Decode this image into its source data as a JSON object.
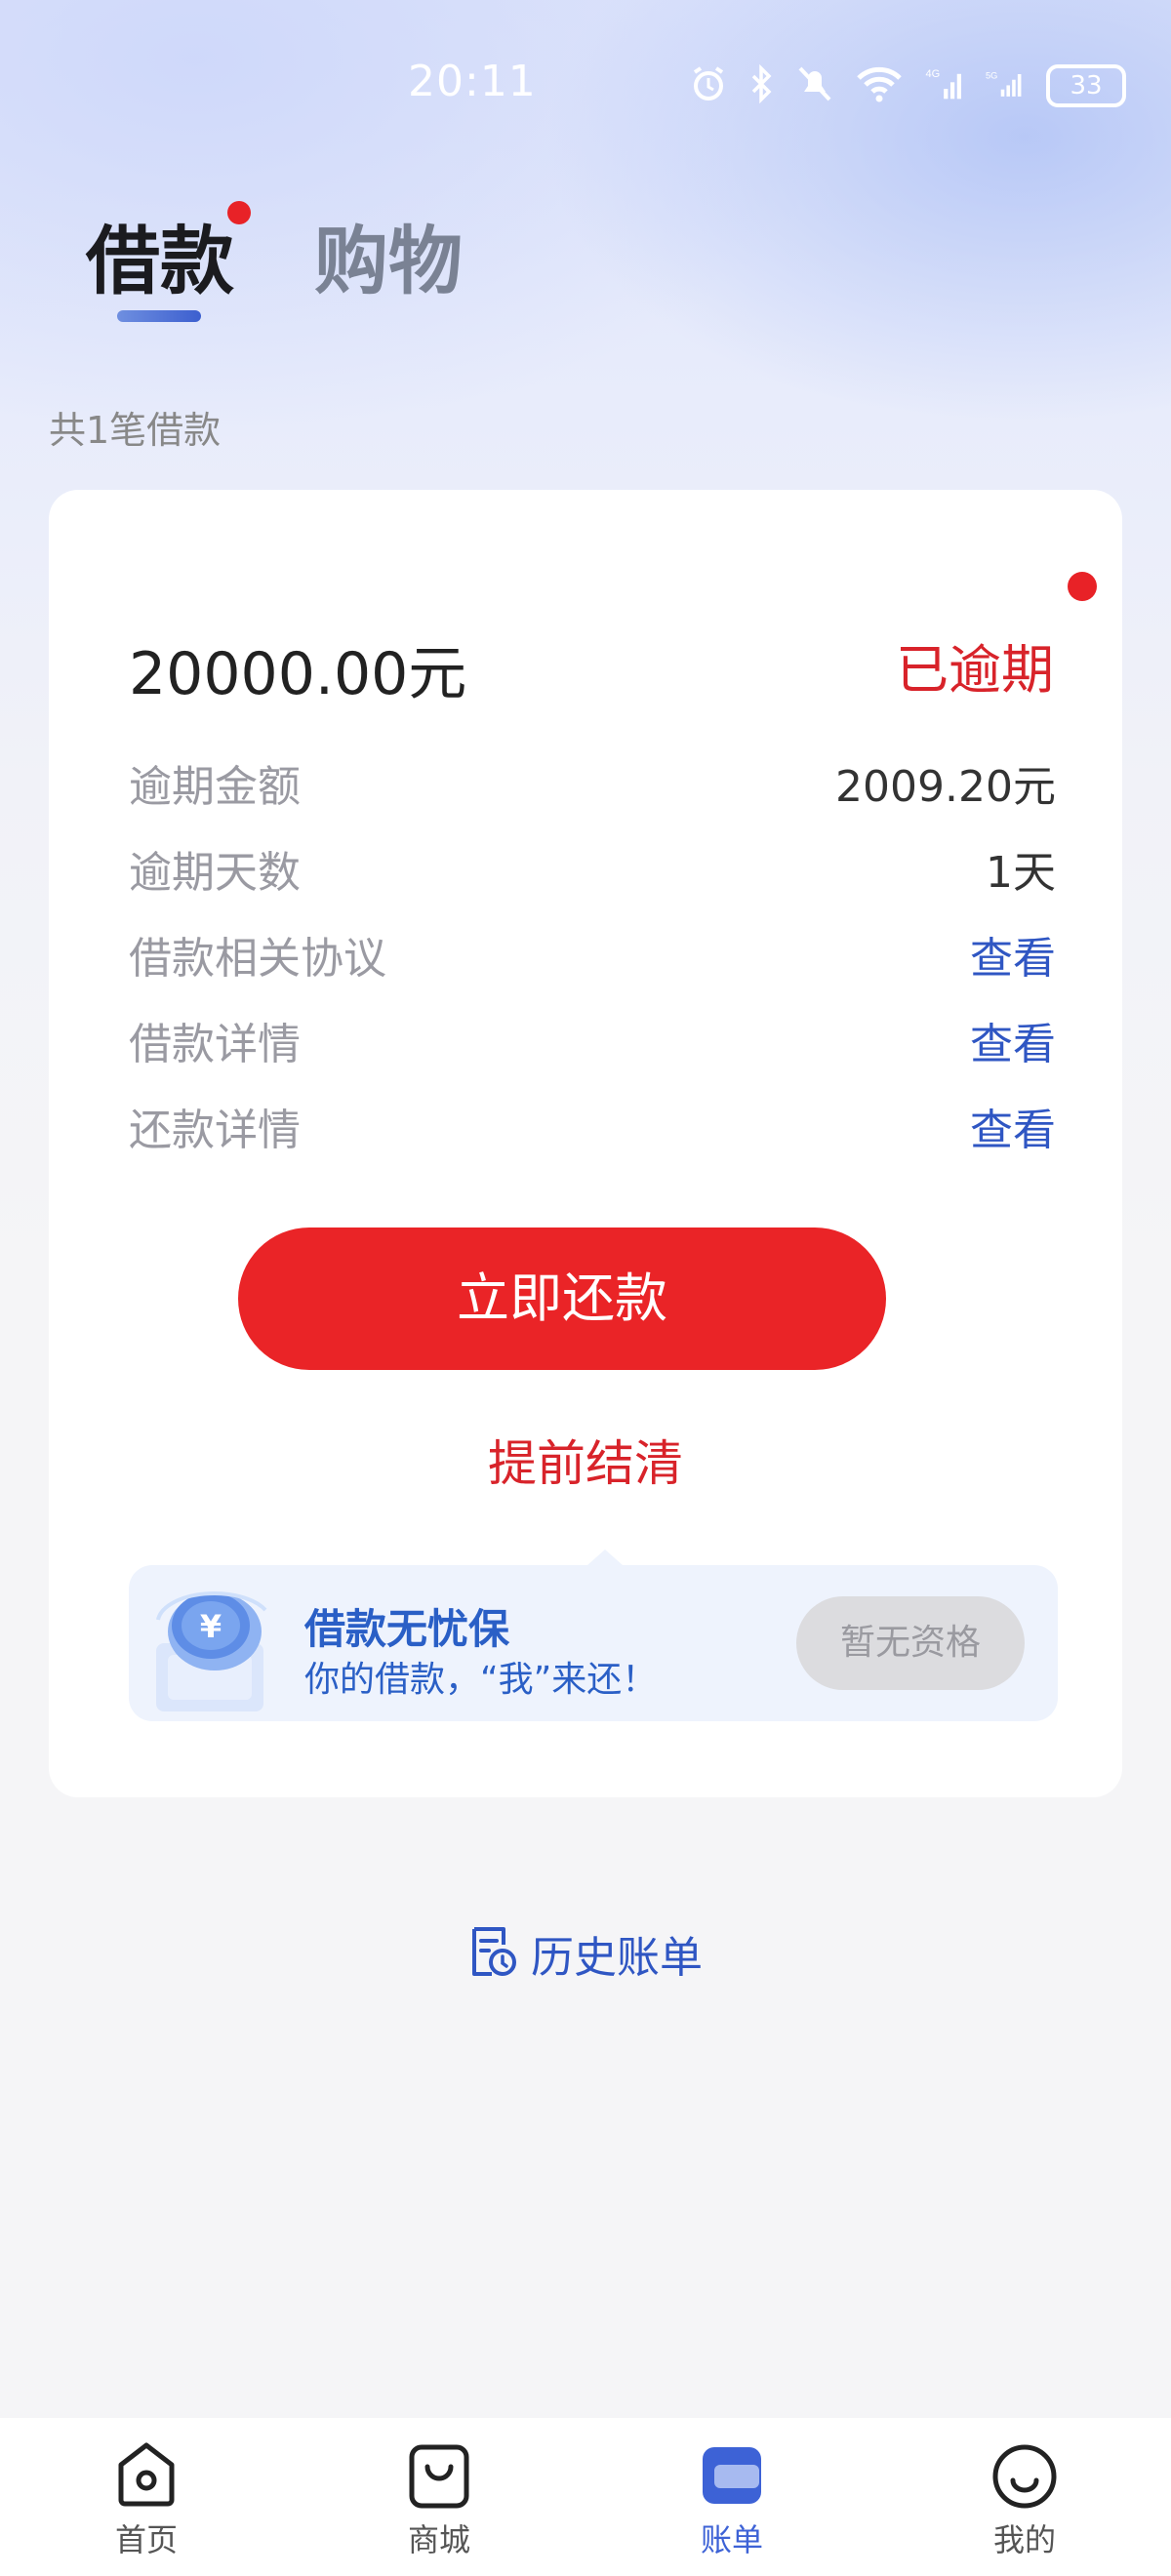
{
  "status_bar": {
    "time": "20:11",
    "battery": "33"
  },
  "tabs": {
    "loan": "借款",
    "shopping": "购物"
  },
  "loan_count": "共1笔借款",
  "loan_card": {
    "amount": "20000.00元",
    "status": "已逾期",
    "rows": [
      {
        "label": "逾期金额",
        "value": "2009.20元"
      },
      {
        "label": "逾期天数",
        "value": "1天"
      },
      {
        "label": "借款相关协议",
        "link": "查看"
      },
      {
        "label": "借款详情",
        "link": "查看"
      },
      {
        "label": "还款详情",
        "link": "查看"
      }
    ],
    "repay_button": "立即还款",
    "settle_link": "提前结清"
  },
  "promo": {
    "title": "借款无忧保",
    "subtitle": "你的借款，“我”来还！",
    "button": "暂无资格"
  },
  "history_bill": "历史账单",
  "bottom_nav": [
    {
      "label": "首页",
      "icon": "home-icon"
    },
    {
      "label": "商城",
      "icon": "shopping-bag-icon"
    },
    {
      "label": "账单",
      "icon": "bill-icon",
      "active": true
    },
    {
      "label": "我的",
      "icon": "profile-icon"
    }
  ],
  "colors": {
    "accent_red": "#ea2427",
    "link_blue": "#2f56c3",
    "active_nav": "#3d62d6"
  }
}
